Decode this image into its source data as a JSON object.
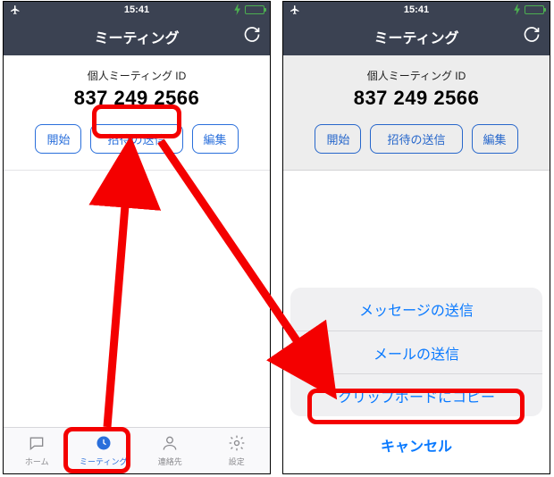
{
  "status": {
    "time": "15:41"
  },
  "header": {
    "title": "ミーティング"
  },
  "pmi": {
    "label": "個人ミーティング ID",
    "number": "837 249 2566"
  },
  "buttons": {
    "start": "開始",
    "invite": "招待の送信",
    "edit": "編集"
  },
  "tabs": {
    "home": "ホーム",
    "meetings": "ミーティング",
    "contacts": "連絡先",
    "settings": "設定"
  },
  "sheet": {
    "message": "メッセージの送信",
    "mail": "メールの送信",
    "clipboard": "クリップボードにコピー",
    "cancel": "キャンセル"
  },
  "colors": {
    "accent": "#2a6fdb",
    "annotation": "#f40000"
  }
}
